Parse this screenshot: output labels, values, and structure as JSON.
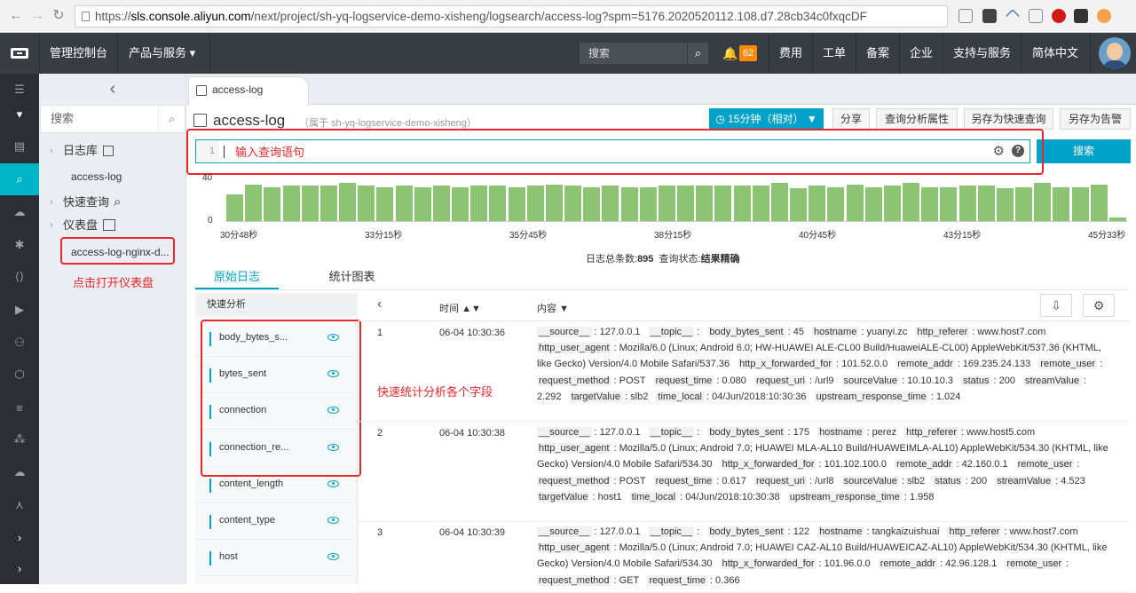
{
  "browser": {
    "url_prefix": "https://",
    "url_host": "sls.console.aliyun.com",
    "url_path": "/next/project/sh-yq-logservice-demo-xisheng/logsearch/access-log?spm=5176.2020520112.108.d7.28cb34c0fxqcDF"
  },
  "topbar": {
    "console": "管理控制台",
    "products": "产品与服务",
    "products_arrow": "▾",
    "search_placeholder": "搜索",
    "notifications": "62",
    "menu": [
      "费用",
      "工单",
      "备案",
      "企业",
      "支持与服务",
      "简体中文"
    ]
  },
  "sidebar": {
    "search_placeholder": "搜索",
    "logstore_label": "日志库",
    "logstore_item": "access-log",
    "quick_query_label": "快速查询",
    "dashboard_label": "仪表盘",
    "dashboard_item": "access-log-nginx-d...",
    "annotation": "点击打开仪表盘"
  },
  "tab": {
    "label": "access-log"
  },
  "header": {
    "title": "access-log",
    "subtitle": "（属于 sh-yq-logservice-demo-xisheng）",
    "time_range": "15分钟（相对）",
    "share": "分享",
    "query_props": "查询分析属性",
    "save_quick": "另存为快速查询",
    "save_alarm": "另存为告警"
  },
  "query": {
    "line_no": "1",
    "placeholder_annotation": "输入查询语句",
    "search_button": "搜索"
  },
  "chart_data": {
    "type": "bar",
    "ylim": [
      0,
      40
    ],
    "y_ticks": [
      "40",
      "0"
    ],
    "x_ticks": [
      "30分48秒",
      "33分15秒",
      "35分45秒",
      "38分15秒",
      "40分45秒",
      "43分15秒",
      "45分33秒"
    ],
    "values": [
      22,
      30,
      28,
      29,
      29,
      29,
      31,
      29,
      28,
      29,
      28,
      29,
      28,
      29,
      29,
      28,
      29,
      30,
      29,
      28,
      29,
      28,
      28,
      29,
      29,
      29,
      29,
      29,
      29,
      31,
      27,
      29,
      28,
      30,
      28,
      29,
      31,
      28,
      28,
      29,
      29,
      27,
      28,
      31,
      28,
      28,
      30,
      3
    ]
  },
  "stats": {
    "total_label": "日志总条数:",
    "total": "895",
    "status_label": "查询状态:",
    "status": "结果精确"
  },
  "log_tabs": [
    "原始日志",
    "统计图表"
  ],
  "quick_analysis": {
    "title": "快速分析",
    "fields": [
      "body_bytes_s...",
      "bytes_sent",
      "connection",
      "connection_re...",
      "content_length",
      "content_type",
      "host"
    ],
    "annotation": "快速统计分析各个字段"
  },
  "table": {
    "collapse": "‹",
    "col_time": "时间",
    "col_time_sort": "▲▼",
    "col_content": "内容",
    "col_content_sort": "▼",
    "download_icon": "⇩",
    "settings_icon": "⚙",
    "rows": [
      {
        "index": "1",
        "time": "06-04 10:30:36",
        "fields": [
          [
            "__source__",
            "127.0.0.1"
          ],
          [
            "__topic__",
            ""
          ],
          [
            "body_bytes_sent",
            "45"
          ],
          [
            "hostname",
            "yuanyi.zc"
          ],
          [
            "http_referer",
            "www.host7.com"
          ],
          [
            "http_user_agent",
            "Mozilla/6.0 (Linux; Android 6.0; HW-HUAWEI ALE-CL00 Build/HuaweiALE-CL00) AppleWebKit/537.36 (KHTML, like Gecko) Version/4.0 Mobile Safari/537.36"
          ],
          [
            "http_x_forwarded_for",
            "101.52.0.0"
          ],
          [
            "remote_addr",
            "169.235.24.133"
          ],
          [
            "remote_user",
            ""
          ],
          [
            "request_method",
            "POST"
          ],
          [
            "request_time",
            "0.080"
          ],
          [
            "request_uri",
            "/url9"
          ],
          [
            "sourceValue",
            "10.10.10.3"
          ],
          [
            "status",
            "200"
          ],
          [
            "streamValue",
            "2.292"
          ],
          [
            "targetValue",
            "slb2"
          ],
          [
            "time_local",
            "04/Jun/2018:10:30:36"
          ],
          [
            "upstream_response_time",
            "1.024"
          ]
        ]
      },
      {
        "index": "2",
        "time": "06-04 10:30:38",
        "fields": [
          [
            "__source__",
            "127.0.0.1"
          ],
          [
            "__topic__",
            ""
          ],
          [
            "body_bytes_sent",
            "175"
          ],
          [
            "hostname",
            "perez"
          ],
          [
            "http_referer",
            "www.host5.com"
          ],
          [
            "http_user_agent",
            "Mozilla/5.0 (Linux; Android 7.0; HUAWEI MLA-AL10 Build/HUAWEIMLA-AL10) AppleWebKit/534.30 (KHTML, like Gecko) Version/4.0 Mobile Safari/534.30"
          ],
          [
            "http_x_forwarded_for",
            "101.102.100.0"
          ],
          [
            "remote_addr",
            "42.160.0.1"
          ],
          [
            "remote_user",
            ""
          ],
          [
            "request_method",
            "POST"
          ],
          [
            "request_time",
            "0.617"
          ],
          [
            "request_uri",
            "/url8"
          ],
          [
            "sourceValue",
            "slb2"
          ],
          [
            "status",
            "200"
          ],
          [
            "streamValue",
            "4.523"
          ],
          [
            "targetValue",
            "host1"
          ],
          [
            "time_local",
            "04/Jun/2018:10:30:38"
          ],
          [
            "upstream_response_time",
            "1.958"
          ]
        ]
      },
      {
        "index": "3",
        "time": "06-04 10:30:39",
        "fields": [
          [
            "__source__",
            "127.0.0.1"
          ],
          [
            "__topic__",
            ""
          ],
          [
            "body_bytes_sent",
            "122"
          ],
          [
            "hostname",
            "tangkaizuishuai"
          ],
          [
            "http_referer",
            "www.host7.com"
          ],
          [
            "http_user_agent",
            "Mozilla/5.0 (Linux; Android 7.0; HUAWEI CAZ-AL10 Build/HUAWEICAZ-AL10) AppleWebKit/534.30 (KHTML, like Gecko) Version/4.0 Mobile Safari/534.30"
          ],
          [
            "http_x_forwarded_for",
            "101.96.0.0"
          ],
          [
            "remote_addr",
            "42.96.128.1"
          ],
          [
            "remote_user",
            ""
          ],
          [
            "request_method",
            "GET"
          ],
          [
            "request_time",
            "0.366"
          ]
        ]
      }
    ]
  }
}
